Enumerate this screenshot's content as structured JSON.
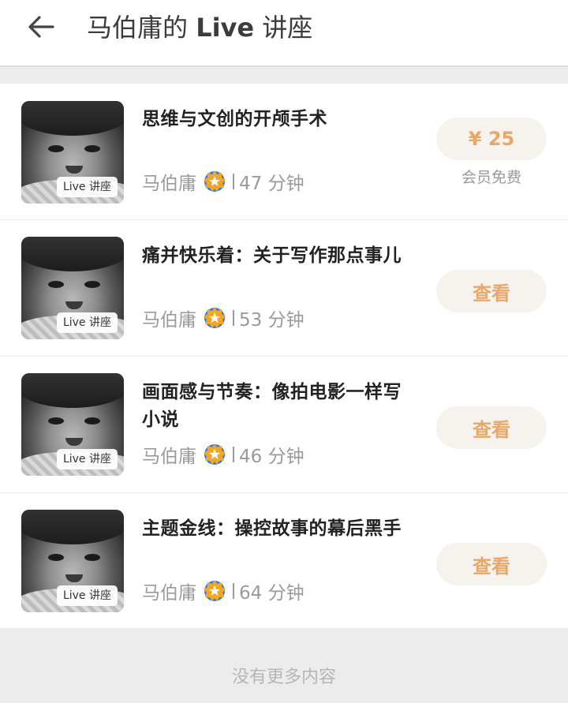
{
  "header": {
    "title_prefix": "马伯庸的 ",
    "title_live": "Live",
    "title_suffix": " 讲座",
    "back_icon": "arrow-left-icon"
  },
  "lectures": [
    {
      "title": "思维与文创的开颅手术",
      "author": "马伯庸",
      "duration": "47 分钟",
      "tag": "Live 讲座",
      "action_label": "¥ 25",
      "note": "会员免费"
    },
    {
      "title": "痛并快乐着：关于写作那点事儿",
      "author": "马伯庸",
      "duration": "53 分钟",
      "tag": "Live 讲座",
      "action_label": "查看"
    },
    {
      "title": "画面感与节奏：像拍电影一样写小说",
      "author": "马伯庸",
      "duration": "46 分钟",
      "tag": "Live 讲座",
      "action_label": "查看"
    },
    {
      "title": "主题金线：操控故事的幕后黑手",
      "author": "马伯庸",
      "duration": "64 分钟",
      "tag": "Live 讲座",
      "action_label": "查看"
    }
  ],
  "footer": {
    "text": "没有更多内容"
  },
  "colors": {
    "accent": "#e9a767",
    "pill_bg": "#f6f2ee",
    "badge_orange": "#f5a623",
    "badge_blue": "#2f80ed"
  }
}
